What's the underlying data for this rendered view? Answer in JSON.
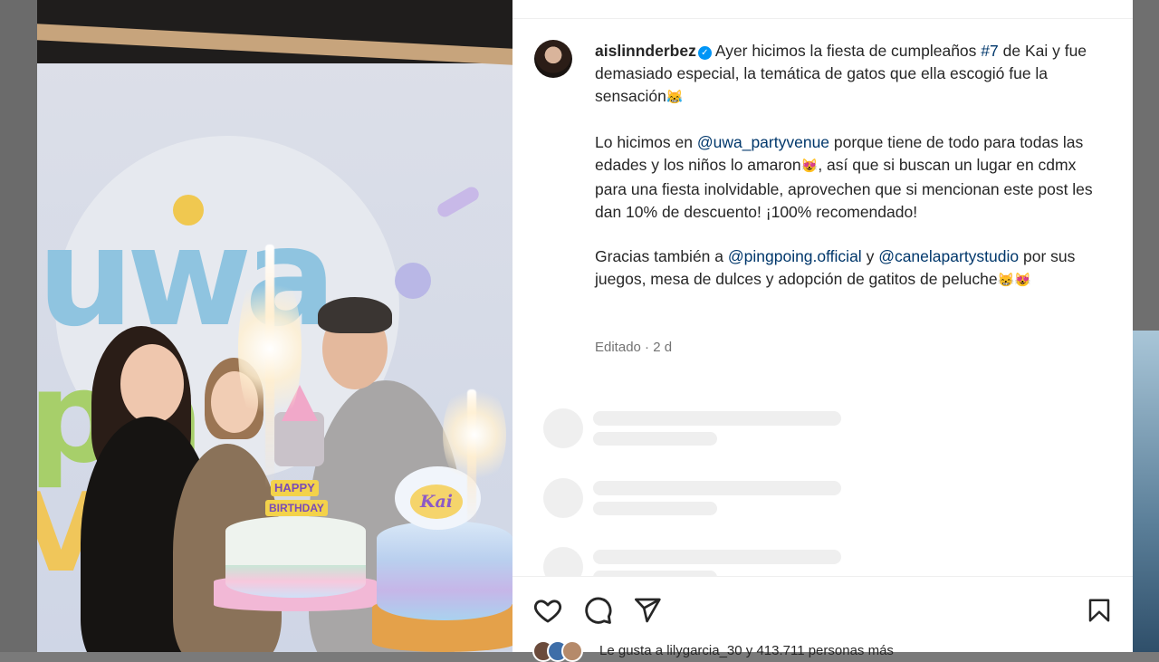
{
  "post": {
    "username": "aislinnderbez",
    "caption": {
      "p1": {
        "text_a": "Ayer hicimos la fiesta de cumpleaños ",
        "hashtag": "#7",
        "text_b": " de Kai y fue demasiado especial, la temática de gatos que ella escogió fue la sensación",
        "emoji": "😹"
      },
      "p2": {
        "text_a": "Lo hicimos en ",
        "mention": "@uwa_partyvenue",
        "text_b": " porque tiene de todo para todas las edades y los niños lo amaron",
        "emoji": "😻",
        "text_c": ", así que si buscan un lugar en cdmx para una fiesta inolvidable, aprovechen que si mencionan este post les dan 10% de descuento! ¡100% recomendado!"
      },
      "p3": {
        "text_a": "Gracias también a ",
        "mention1": "@pingpoing.official",
        "text_b": " y ",
        "mention2": "@canelapartystudio",
        "text_c": " por sus juegos, mesa de dulces y adopción de gatitos de peluche",
        "emoji": "😸😻"
      }
    },
    "meta": "Editado · 2 d",
    "likes_text": "Le gusta a lilygarcia_30 y 413.711 personas más",
    "photo_sign": {
      "wordmark_1": "uwa",
      "wordmark_2": "pa",
      "wordmark_3": "V",
      "candle_top": "HAPPY",
      "candle_bottom": "BIRTHDAY",
      "cake_topper": "Kai"
    }
  },
  "actions": {
    "like_icon": "heart-icon",
    "comment_icon": "comment-icon",
    "share_icon": "send-icon",
    "save_icon": "bookmark-icon"
  },
  "colors": {
    "link": "#00376b",
    "verified": "#0095f6",
    "skeleton": "#efefef"
  }
}
